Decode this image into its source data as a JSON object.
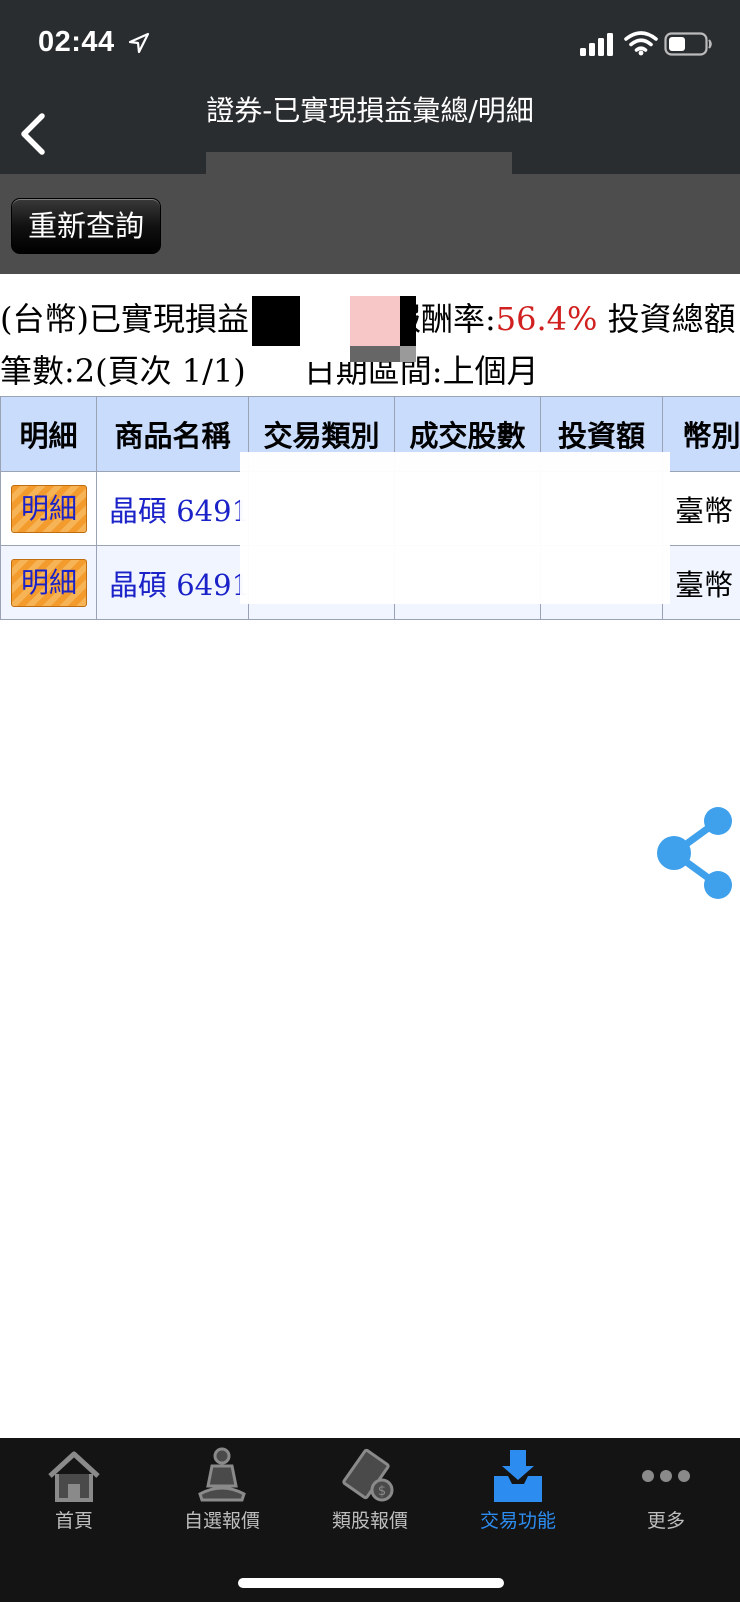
{
  "status": {
    "time": "02:44"
  },
  "nav": {
    "title": "證券-已實現損益彙總/明細"
  },
  "toolbar": {
    "requery_label": "重新查詢"
  },
  "summary": {
    "line1_prefix": "(台幣)已實現損益",
    "return_label": "報酬率:",
    "return_value": "56.4%",
    "invest_total_label": "投資總額",
    "count_text": "筆數:2(頁次 1/1)",
    "date_range": "日期區間:上個月"
  },
  "table": {
    "headers": [
      "明細",
      "商品名稱",
      "交易類別",
      "成交股數",
      "投資額",
      "幣別"
    ],
    "rows": [
      {
        "detail": "明細",
        "product": "晶碩 6491",
        "trade_type": "",
        "shares": "",
        "amount": "",
        "currency": "臺幣"
      },
      {
        "detail": "明細",
        "product": "晶碩 6491",
        "trade_type": "",
        "shares": "",
        "amount": "",
        "currency": "臺幣"
      }
    ]
  },
  "tabs": [
    {
      "label": "首頁",
      "icon": "home-icon"
    },
    {
      "label": "自選報價",
      "icon": "meditation-icon"
    },
    {
      "label": "類股報價",
      "icon": "film-money-icon"
    },
    {
      "label": "交易功能",
      "icon": "inbox-download-icon",
      "active": true
    },
    {
      "label": "更多",
      "icon": "more-dots-icon"
    }
  ],
  "colors": {
    "accent": "#2d8cf0",
    "highlight": "#d02020",
    "header_bg": "#c9dcfb"
  }
}
